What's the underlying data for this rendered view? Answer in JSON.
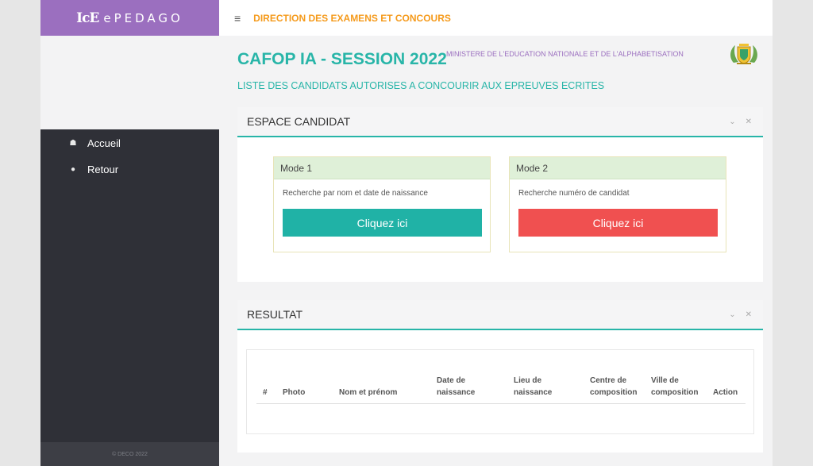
{
  "brand": {
    "glyph": "IcE",
    "name": "ePEDAGO"
  },
  "topbar": {
    "title": "DIRECTION DES EXAMENS ET CONCOURS"
  },
  "sidebar": {
    "items": [
      {
        "label": "Accueil",
        "icon": "home-icon"
      },
      {
        "label": "Retour",
        "icon": "globe-icon"
      }
    ],
    "footer": "© DECO 2022"
  },
  "header": {
    "ministry": "MINISTERE DE L'EDUCATION NATIONALE ET DE L'ALPHABETISATION",
    "title": "CAFOP IA - SESSION 2022",
    "subtitle": "LISTE DES CANDIDATS AUTORISES A CONCOURIR AUX EPREUVES ECRITES"
  },
  "espace": {
    "title": "ESPACE CANDIDAT",
    "modes": [
      {
        "title": "Mode 1",
        "description": "Recherche par nom et date de naissance",
        "button": "Cliquez ici",
        "color": "#20b2a6"
      },
      {
        "title": "Mode 2",
        "description": "Recherche numéro de candidat",
        "button": "Cliquez ici",
        "color": "#f05050"
      }
    ]
  },
  "resultat": {
    "title": "RESULTAT",
    "columns": [
      {
        "line1": "#"
      },
      {
        "line1": "Photo"
      },
      {
        "line1": "Nom et prénom"
      },
      {
        "line1": "Date de",
        "line2": "naissance"
      },
      {
        "line1": "Lieu de",
        "line2": "naissance"
      },
      {
        "line1": "Centre de",
        "line2": "composition"
      },
      {
        "line1": "Ville de",
        "line2": "composition"
      },
      {
        "line1": "Action"
      }
    ]
  },
  "colors": {
    "accent": "#28b5a8",
    "brand": "#9b6fbf",
    "warning": "#f59a1b",
    "danger": "#f05050"
  }
}
